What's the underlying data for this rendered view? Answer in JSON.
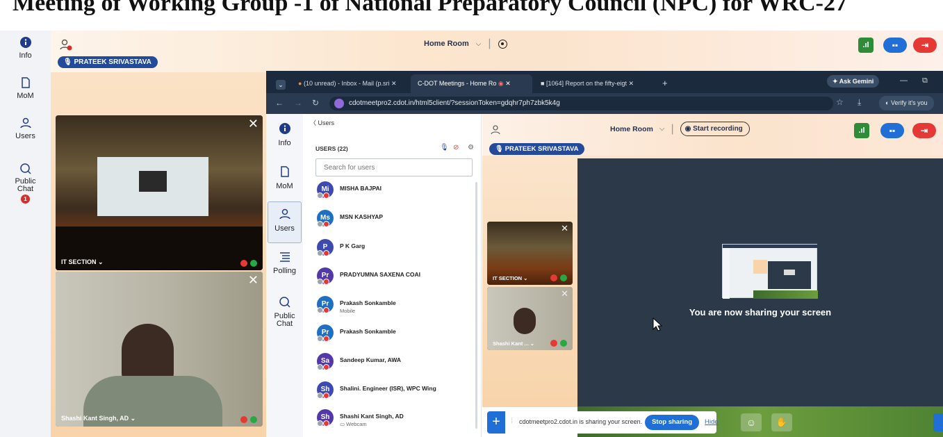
{
  "heading": "Meeting of Working Group -1 of National Preparatory Council (NPC) for WRC-27",
  "outer_app": {
    "sidebar": [
      {
        "label": "Info",
        "icon": "info-icon"
      },
      {
        "label": "MoM",
        "icon": "document-icon"
      },
      {
        "label": "Users",
        "icon": "user-icon"
      },
      {
        "label": "Public Chat",
        "icon": "chat-icon",
        "badge": "1"
      }
    ],
    "presenter_name": "PRATEEK SRIVASTAVA",
    "room_name": "Home Room",
    "tiles": [
      {
        "label": "IT SECTION ⌄"
      },
      {
        "label": "Shashi Kant Singh, AD ⌄"
      }
    ]
  },
  "browser": {
    "tabs": [
      {
        "label": "(10 unread) - Inbox - Mail (p.sri"
      },
      {
        "label": "C-DOT Meetings - Home Ro"
      },
      {
        "label": "[1064] Report on the fifty-eigt"
      }
    ],
    "new_tab": "+",
    "ask_gemini": "Ask Gemini",
    "url": "cdotmeetpro2.cdot.in/html5client/?sessionToken=gdqhr7ph7zbk5k4g",
    "verify": "Verify it's you"
  },
  "inner_app": {
    "sidebar": [
      {
        "label": "Info",
        "icon": "info-icon"
      },
      {
        "label": "MoM",
        "icon": "document-icon"
      },
      {
        "label": "Users",
        "icon": "user-icon"
      },
      {
        "label": "Polling",
        "icon": "list-icon"
      },
      {
        "label": "Public Chat",
        "icon": "chat-icon"
      }
    ],
    "panel": {
      "back_label": "Users",
      "users_count": "USERS (22)",
      "search_placeholder": "Search for users",
      "users": [
        {
          "initials": "Mi",
          "name": "MISHA BAJPAI",
          "sub": ""
        },
        {
          "initials": "Ms",
          "name": "MSN KASHYAP",
          "sub": ""
        },
        {
          "initials": "P",
          "name": "P K Garg",
          "sub": ""
        },
        {
          "initials": "Pr",
          "name": "PRADYUMNA SAXENA COAI",
          "sub": ""
        },
        {
          "initials": "Pr",
          "name": "Prakash Sonkamble",
          "sub": "Mobile"
        },
        {
          "initials": "Pr",
          "name": "Prakash Sonkamble",
          "sub": ""
        },
        {
          "initials": "Sa",
          "name": "Sandeep Kumar, AWA",
          "sub": ""
        },
        {
          "initials": "Sh",
          "name": "Shalini. Engineer (ISR), WPC Wing",
          "sub": ""
        },
        {
          "initials": "Sh",
          "name": "Shashi Kant Singh, AD",
          "sub": "▭ Webcam"
        }
      ]
    },
    "presenter_name": "PRATEEK SRIVASTAVA",
    "room_name": "Home Room",
    "start_recording": "Start recording",
    "tiles": [
      {
        "label": "IT SECTION ⌄"
      },
      {
        "label": "Shashi Kant ... ⌄"
      }
    ],
    "sharing_message": "You are now sharing your screen",
    "share_bar": {
      "text": "cdotmeetpro2.cdot.in is sharing your screen.",
      "stop": "Stop sharing",
      "hide": "Hide"
    }
  },
  "colors": {
    "brand_blue": "#244a9c",
    "leave_red": "#e53935",
    "stats_green": "#2e8b3a",
    "apps_blue": "#1f6fd6"
  }
}
